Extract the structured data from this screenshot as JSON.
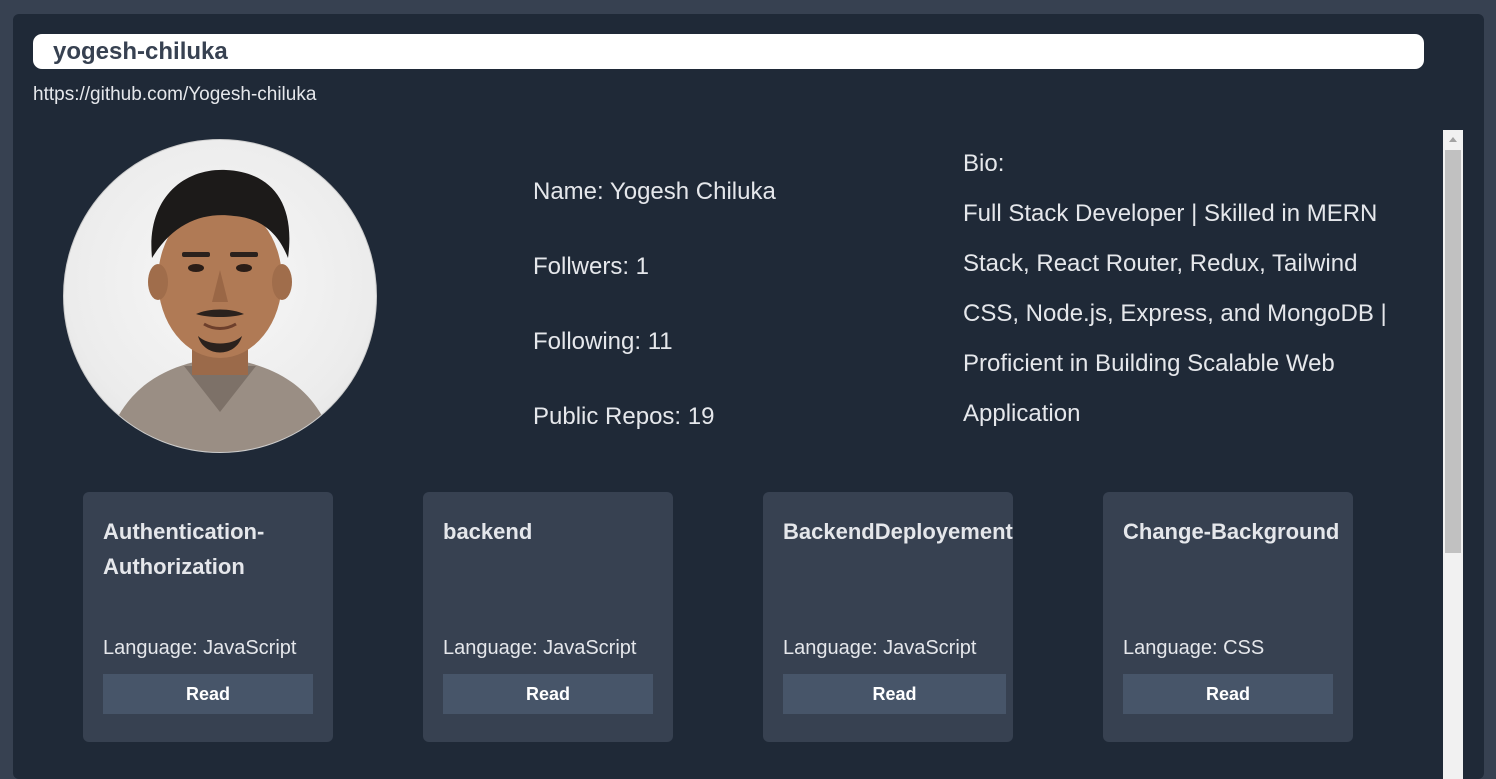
{
  "search": {
    "value": "yogesh-chiluka"
  },
  "profile": {
    "url": "https://github.com/Yogesh-chiluka",
    "avatar_alt": "avatar",
    "name": "Name: Yogesh Chiluka",
    "followers": "Follwers: 1",
    "following": "Following: 11",
    "public_repos": "Public Repos: 19",
    "bio_label": "Bio:",
    "bio_text": "Full Stack Developer | Skilled in MERN Stack, React Router, Redux, Tailwind CSS, Node.js, Express, and MongoDB | Proficient in Building Scalable Web Application"
  },
  "repos": [
    {
      "name": "Authentication-Authorization",
      "language": "Language: JavaScript",
      "button": "Read"
    },
    {
      "name": "backend",
      "language": "Language: JavaScript",
      "button": "Read"
    },
    {
      "name": "BackendDeployement",
      "language": "Language: JavaScript",
      "button": "Read"
    },
    {
      "name": "Change-Background",
      "language": "Language: CSS",
      "button": "Read"
    }
  ],
  "colors": {
    "page_bg": "#374151",
    "panel_bg": "#1f2937",
    "card_bg": "#374151",
    "button_bg": "#475569",
    "text": "#e5e7eb"
  }
}
